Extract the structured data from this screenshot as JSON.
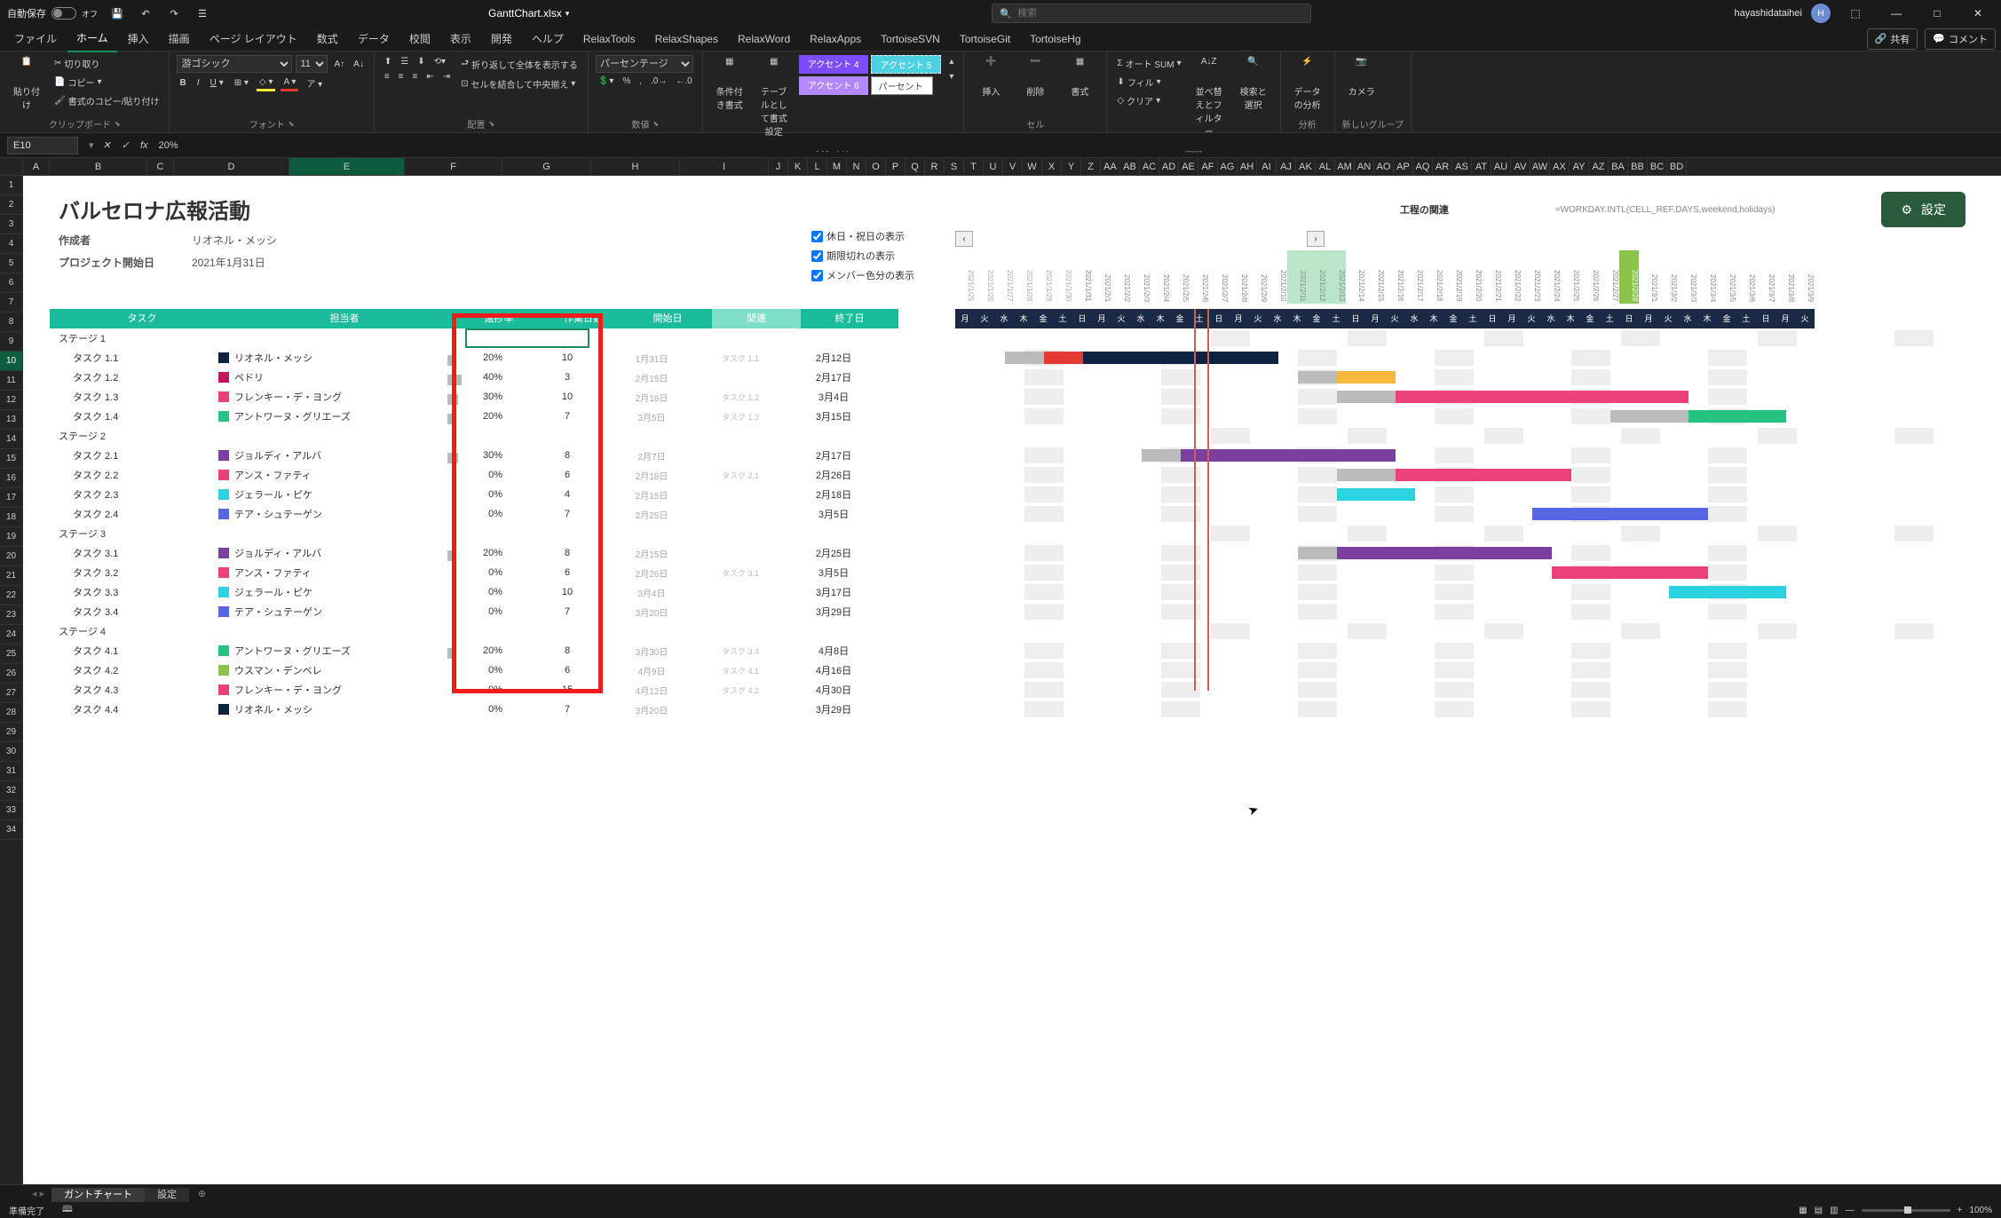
{
  "titlebar": {
    "autosave_label": "自動保存",
    "autosave_state": "オフ",
    "filename": "GanttChart.xlsx",
    "search_placeholder": "検索",
    "username": "hayashidataihei",
    "avatar_initial": "H"
  },
  "tabs": {
    "items": [
      "ファイル",
      "ホーム",
      "挿入",
      "描画",
      "ページ レイアウト",
      "数式",
      "データ",
      "校閲",
      "表示",
      "開発",
      "ヘルプ",
      "RelaxTools",
      "RelaxShapes",
      "RelaxWord",
      "RelaxApps",
      "TortoiseSVN",
      "TortoiseGit",
      "TortoiseHg"
    ],
    "active_index": 1,
    "share": "共有",
    "comment": "コメント"
  },
  "ribbon": {
    "clipboard": {
      "paste": "貼り付け",
      "cut": "切り取り",
      "copy": "コピー",
      "format_painter": "書式のコピー/貼り付け",
      "label": "クリップボード"
    },
    "font": {
      "name": "游ゴシック",
      "size": "11",
      "label": "フォント"
    },
    "alignment": {
      "wrap": "折り返して全体を表示する",
      "merge": "セルを結合して中央揃え",
      "label": "配置"
    },
    "number": {
      "format": "パーセンテージ",
      "label": "数値"
    },
    "style": {
      "cond": "条件付き書式",
      "table": "テーブルとして書式設定",
      "acc4": "アクセント 4",
      "acc5": "アクセント 5",
      "acc6": "アクセント 6",
      "percent": "パーセント",
      "label": "スタイル"
    },
    "cells": {
      "insert": "挿入",
      "delete": "削除",
      "format": "書式",
      "label": "セル"
    },
    "editing": {
      "autosum": "オート SUM",
      "fill": "フィル",
      "clear": "クリア",
      "sort": "並べ替えとフィルター",
      "find": "検索と選択",
      "label": "編集"
    },
    "analysis": {
      "analyze": "データの分析",
      "label": "分析"
    },
    "camera": {
      "camera": "カメラ",
      "label": "新しいグループ"
    }
  },
  "formula_bar": {
    "cell_ref": "E10",
    "value": "20%"
  },
  "col_headers": [
    "A",
    "B",
    "C",
    "D",
    "E",
    "F",
    "G",
    "H",
    "I",
    "J",
    "K",
    "L",
    "M",
    "N",
    "O",
    "P",
    "Q",
    "R",
    "S",
    "T",
    "U",
    "V",
    "W",
    "X",
    "Y",
    "Z",
    "AA",
    "AB",
    "AC",
    "AD",
    "AE",
    "AF",
    "AG",
    "AH",
    "AI",
    "AJ",
    "AK",
    "AL",
    "AM",
    "AN",
    "AO",
    "AP",
    "AQ",
    "AR",
    "AS",
    "AT",
    "AU",
    "AV",
    "AW",
    "AX",
    "AY",
    "AZ",
    "BA",
    "BB",
    "BC",
    "BD"
  ],
  "row_headers_count": 34,
  "project": {
    "title": "バルセロナ広報活動",
    "creator_label": "作成者",
    "creator": "リオネル・メッシ",
    "start_label": "プロジェクト開始日",
    "start": "2021年1月31日",
    "engineering": "工程の関連",
    "formula": "=WORKDAY.INTL(CELL_REF,DAYS,weekend,holidays)",
    "settings": "設定",
    "checks": [
      "休日・祝日の表示",
      "期限切れの表示",
      "メンバー色分の表示"
    ]
  },
  "table_header": {
    "task": "タスク",
    "assignee": "担当者",
    "progress": "進捗率",
    "days": "作業日数",
    "start": "開始日",
    "rel": "関連",
    "end": "終了日"
  },
  "dates": [
    "2021/1/25",
    "2021/1/26",
    "2021/1/27",
    "2021/1/28",
    "2021/1/29",
    "2021/1/30",
    "2021/1/31",
    "2021/2/1",
    "2021/2/2",
    "2021/2/3",
    "2021/2/4",
    "2021/2/5",
    "2021/2/6",
    "2021/2/7",
    "2021/2/8",
    "2021/2/9",
    "2021/2/10",
    "2021/2/11",
    "2021/2/12",
    "2021/2/13",
    "2021/2/14",
    "2021/2/15",
    "2021/2/16",
    "2021/2/17",
    "2021/2/18",
    "2021/2/19",
    "2021/2/20",
    "2021/2/21",
    "2021/2/22",
    "2021/2/23",
    "2021/2/24",
    "2021/2/25",
    "2021/2/26",
    "2021/2/27",
    "2021/2/28",
    "2021/3/1",
    "2021/3/2",
    "2021/3/3",
    "2021/3/4",
    "2021/3/5",
    "2021/3/6",
    "2021/3/7",
    "2021/3/8",
    "2021/3/9"
  ],
  "dow": [
    "月",
    "火",
    "水",
    "木",
    "金",
    "土",
    "日",
    "月",
    "火",
    "水",
    "木",
    "金",
    "土",
    "日",
    "月",
    "火",
    "水",
    "木",
    "金",
    "土",
    "日",
    "月",
    "火",
    "水",
    "木",
    "金",
    "土",
    "日",
    "月",
    "火",
    "水",
    "木",
    "金",
    "土",
    "日",
    "月",
    "火",
    "水",
    "木",
    "金",
    "土",
    "日",
    "月",
    "火"
  ],
  "today_index": 34,
  "rows": [
    {
      "type": "stage",
      "task": "ステージ 1"
    },
    {
      "type": "task",
      "task": "タスク 1.1",
      "chip": "#0d2340",
      "assignee": "リオネル・メッシ",
      "progress": "20%",
      "days": "10",
      "start": "1月31日",
      "rel": "タスク 1.1",
      "end": "2月12日",
      "bar": {
        "s": 6,
        "e": 18,
        "color": "#0d2340",
        "done": 2,
        "done_color": "#e53935",
        "gray_s": 4,
        "gray_e": 6
      }
    },
    {
      "type": "task",
      "task": "タスク 1.2",
      "chip": "#c2185b",
      "assignee": "ペドリ",
      "progress": "40%",
      "days": "3",
      "start": "2月15日",
      "rel": "",
      "end": "2月17日",
      "bar": {
        "s": 21,
        "e": 24,
        "color": "#f6b73c",
        "gray_s": 19,
        "gray_e": 21
      }
    },
    {
      "type": "task",
      "task": "タスク 1.3",
      "chip": "#ec407a",
      "assignee": "フレンキー・デ・ヨング",
      "progress": "30%",
      "days": "10",
      "start": "2月18日",
      "rel": "タスク 1.2",
      "end": "3月4日",
      "bar": {
        "s": 24,
        "e": 39,
        "color": "#ec407a",
        "gray_s": 21,
        "gray_e": 24,
        "gray2_s": 31,
        "gray2_e": 35
      }
    },
    {
      "type": "task",
      "task": "タスク 1.4",
      "chip": "#26c281",
      "assignee": "アントワーヌ・グリエーズ",
      "progress": "20%",
      "days": "7",
      "start": "3月5日",
      "rel": "タスク 1.3",
      "end": "3月15日",
      "bar": {
        "s": 39,
        "e": 44,
        "color": "#26c281",
        "gray_s": 35,
        "gray_e": 39
      }
    },
    {
      "type": "stage",
      "task": "ステージ 2"
    },
    {
      "type": "task",
      "task": "タスク 2.1",
      "chip": "#7b3fa0",
      "assignee": "ジョルディ・アルバ",
      "progress": "30%",
      "days": "8",
      "start": "2月7日",
      "rel": "",
      "end": "2月17日",
      "bar": {
        "s": 13,
        "e": 24,
        "color": "#7b3fa0",
        "gray_s": 11,
        "gray_e": 13
      }
    },
    {
      "type": "task",
      "task": "タスク 2.2",
      "chip": "#ec407a",
      "assignee": "アンス・ファティ",
      "progress": "0%",
      "days": "6",
      "start": "2月18日",
      "rel": "タスク 2.1",
      "end": "2月26日",
      "bar": {
        "s": 24,
        "e": 33,
        "color": "#ec407a",
        "gray_s": 21,
        "gray_e": 24
      }
    },
    {
      "type": "task",
      "task": "タスク 2.3",
      "chip": "#29d3e0",
      "assignee": "ジェラール・ピケ",
      "progress": "0%",
      "days": "4",
      "start": "2月15日",
      "rel": "",
      "end": "2月18日",
      "bar": {
        "s": 21,
        "e": 25,
        "color": "#29d3e0"
      }
    },
    {
      "type": "task",
      "task": "タスク 2.4",
      "chip": "#5767e3",
      "assignee": "テア・シュテーゲン",
      "progress": "0%",
      "days": "7",
      "start": "2月25日",
      "rel": "",
      "end": "3月5日",
      "bar": {
        "s": 31,
        "e": 40,
        "color": "#5767e3"
      }
    },
    {
      "type": "stage",
      "task": "ステージ 3"
    },
    {
      "type": "task",
      "task": "タスク 3.1",
      "chip": "#7b3fa0",
      "assignee": "ジョルディ・アルバ",
      "progress": "20%",
      "days": "8",
      "start": "2月15日",
      "rel": "",
      "end": "2月25日",
      "bar": {
        "s": 21,
        "e": 32,
        "color": "#7b3fa0",
        "gray_s": 19,
        "gray_e": 21
      }
    },
    {
      "type": "task",
      "task": "タスク 3.2",
      "chip": "#ec407a",
      "assignee": "アンス・ファティ",
      "progress": "0%",
      "days": "6",
      "start": "2月26日",
      "rel": "タスク 3.1",
      "end": "3月5日",
      "bar": {
        "s": 32,
        "e": 40,
        "color": "#ec407a"
      }
    },
    {
      "type": "task",
      "task": "タスク 3.3",
      "chip": "#29d3e0",
      "assignee": "ジェラール・ピケ",
      "progress": "0%",
      "days": "10",
      "start": "3月4日",
      "rel": "",
      "end": "3月17日",
      "bar": {
        "s": 38,
        "e": 44,
        "color": "#29d3e0"
      }
    },
    {
      "type": "task",
      "task": "タスク 3.4",
      "chip": "#5767e3",
      "assignee": "テア・シュテーゲン",
      "progress": "0%",
      "days": "7",
      "start": "3月20日",
      "rel": "",
      "end": "3月29日"
    },
    {
      "type": "stage",
      "task": "ステージ 4"
    },
    {
      "type": "task",
      "task": "タスク 4.1",
      "chip": "#26c281",
      "assignee": "アントワーヌ・グリエーズ",
      "progress": "20%",
      "days": "8",
      "start": "3月30日",
      "rel": "タスク 3.4",
      "end": "4月8日"
    },
    {
      "type": "task",
      "task": "タスク 4.2",
      "chip": "#8bc34a",
      "assignee": "ウスマン・デンベレ",
      "progress": "0%",
      "days": "6",
      "start": "4月9日",
      "rel": "タスク 4.1",
      "end": "4月16日"
    },
    {
      "type": "task",
      "task": "タスク 4.3",
      "chip": "#ec407a",
      "assignee": "フレンキー・デ・ヨング",
      "progress": "0%",
      "days": "15",
      "start": "4月12日",
      "rel": "タスク 4.2",
      "end": "4月30日"
    },
    {
      "type": "task",
      "task": "タスク 4.4",
      "chip": "#0d2340",
      "assignee": "リオネル・メッシ",
      "progress": "0%",
      "days": "7",
      "start": "3月20日",
      "rel": "",
      "end": "3月29日"
    }
  ],
  "sheet_tabs": {
    "items": [
      "ガントチャート",
      "設定"
    ],
    "active": 0
  },
  "statusbar": {
    "ready": "準備完了",
    "zoom": "100%"
  }
}
